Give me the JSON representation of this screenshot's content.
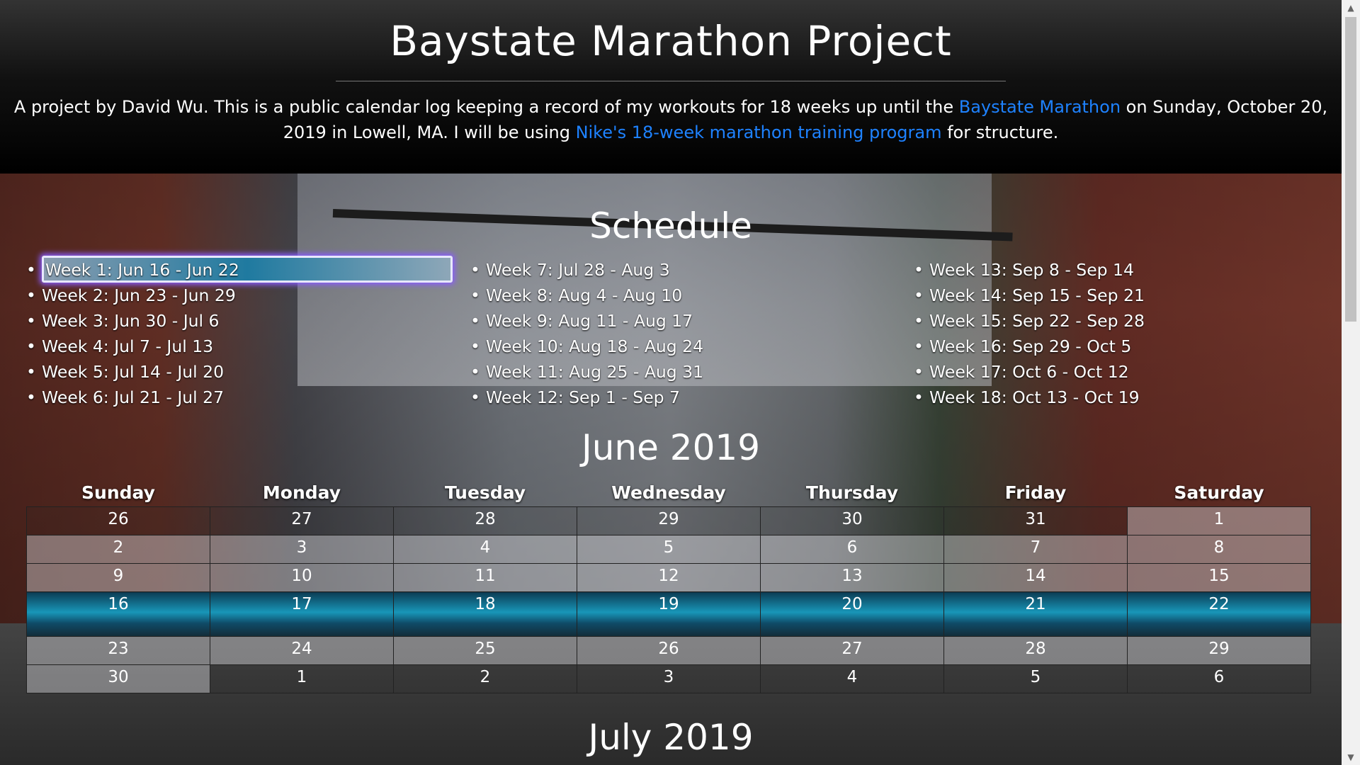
{
  "header": {
    "title": "Baystate Marathon Project",
    "intro_part1": "A project by David Wu. This is a public calendar log keeping a record of my workouts for 18 weeks up until the ",
    "link1": "Baystate Marathon",
    "intro_part2": " on Sunday, October 20, 2019 in Lowell, MA. I will be using ",
    "link2": "Nike's 18-week marathon training program",
    "intro_part3": " for structure."
  },
  "schedule": {
    "title": "Schedule",
    "weeks": [
      "Week 1: Jun 16 - Jun 22",
      "Week 2: Jun 23 - Jun 29",
      "Week 3: Jun 30 - Jul 6",
      "Week 4: Jul 7 - Jul 13",
      "Week 5: Jul 14 - Jul 20",
      "Week 6: Jul 21 - Jul 27",
      "Week 7: Jul 28 - Aug 3",
      "Week 8: Aug 4 - Aug 10",
      "Week 9: Aug 11 - Aug 17",
      "Week 10: Aug 18 - Aug 24",
      "Week 11: Aug 25 - Aug 31",
      "Week 12: Sep 1 - Sep 7",
      "Week 13: Sep 8 - Sep 14",
      "Week 14: Sep 15 - Sep 21",
      "Week 15: Sep 22 - Sep 28",
      "Week 16: Sep 29 - Oct 5",
      "Week 17: Oct 6 - Oct 12",
      "Week 18: Oct 13 - Oct 19"
    ]
  },
  "june": {
    "title": "June 2019",
    "days": [
      "Sunday",
      "Monday",
      "Tuesday",
      "Wednesday",
      "Thursday",
      "Friday",
      "Saturday"
    ],
    "rows": [
      [
        "26",
        "27",
        "28",
        "29",
        "30",
        "31",
        "1"
      ],
      [
        "2",
        "3",
        "4",
        "5",
        "6",
        "7",
        "8"
      ],
      [
        "9",
        "10",
        "11",
        "12",
        "13",
        "14",
        "15"
      ],
      [
        "16",
        "17",
        "18",
        "19",
        "20",
        "21",
        "22"
      ],
      [
        "23",
        "24",
        "25",
        "26",
        "27",
        "28",
        "29"
      ],
      [
        "30",
        "1",
        "2",
        "3",
        "4",
        "5",
        "6"
      ]
    ]
  },
  "july": {
    "title": "July 2019"
  },
  "colors": {
    "link": "#1e82ff",
    "highlight": "#1896b8",
    "focus_glow": "#8a5cff"
  },
  "icons": {
    "scroll_up": "chevron-up-icon",
    "scroll_down": "chevron-down-icon"
  }
}
